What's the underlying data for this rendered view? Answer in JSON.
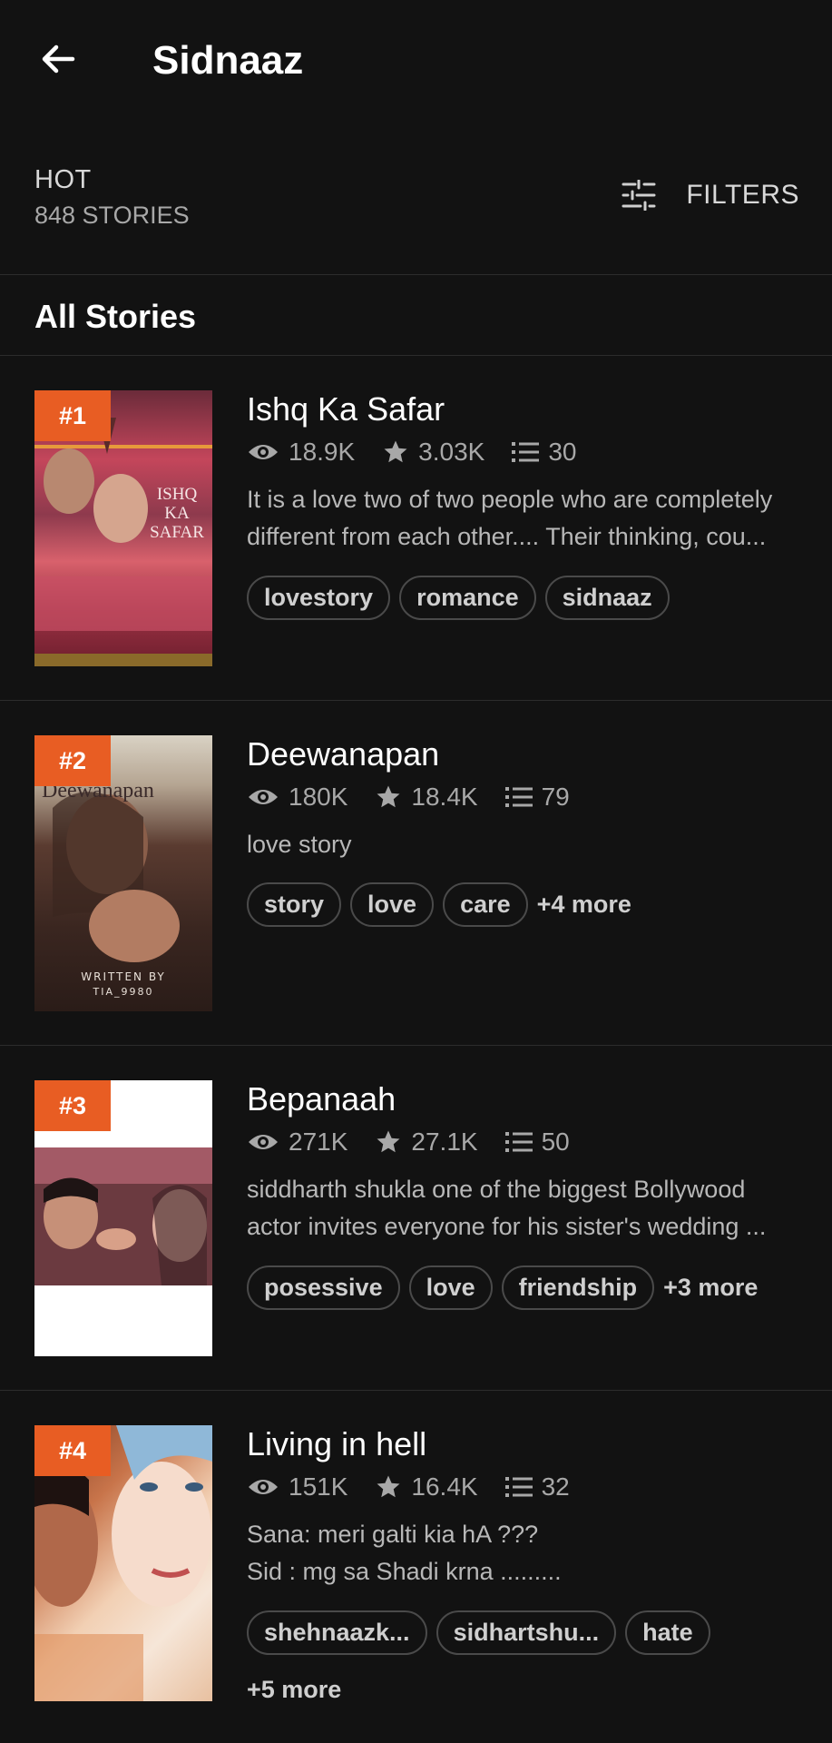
{
  "header": {
    "title": "Sidnaaz"
  },
  "sort": {
    "label": "HOT",
    "count": "848 STORIES",
    "filters_label": "FILTERS"
  },
  "section_title": "All Stories",
  "stories": [
    {
      "rank": "#1",
      "title": "Ishq Ka Safar",
      "reads": "18.9K",
      "votes": "3.03K",
      "parts": "30",
      "description": [
        "It is a love two of two people who are completely",
        "different from each other.... Their thinking, cou..."
      ],
      "tags": [
        "lovestory",
        "romance",
        "sidnaaz"
      ],
      "more": "",
      "cover_text": "ISHQ KA SAFAR"
    },
    {
      "rank": "#2",
      "title": "Deewanapan",
      "reads": "180K",
      "votes": "18.4K",
      "parts": "79",
      "description": [
        "love story"
      ],
      "tags": [
        "story",
        "love",
        "care"
      ],
      "more": "+4 more",
      "cover_text": "Deewanapan"
    },
    {
      "rank": "#3",
      "title": "Bepanaah",
      "reads": "271K",
      "votes": "27.1K",
      "parts": "50",
      "description": [
        "siddharth shukla one of the biggest Bollywood",
        "actor  invites everyone for his sister's wedding ..."
      ],
      "tags": [
        "posessive",
        "love",
        "friendship"
      ],
      "more": "+3 more",
      "cover_text": ""
    },
    {
      "rank": "#4",
      "title": "Living in hell",
      "reads": "151K",
      "votes": "16.4K",
      "parts": "32",
      "description": [
        "Sana: meri galti kia hA ???",
        "Sid : mg sa Shadi krna ........."
      ],
      "tags": [
        "shehnaazk...",
        "sidhartshu...",
        "hate"
      ],
      "more": "+5 more",
      "cover_text": ""
    }
  ],
  "colors": {
    "background": "#121212",
    "rank_badge": "#e85d23"
  }
}
